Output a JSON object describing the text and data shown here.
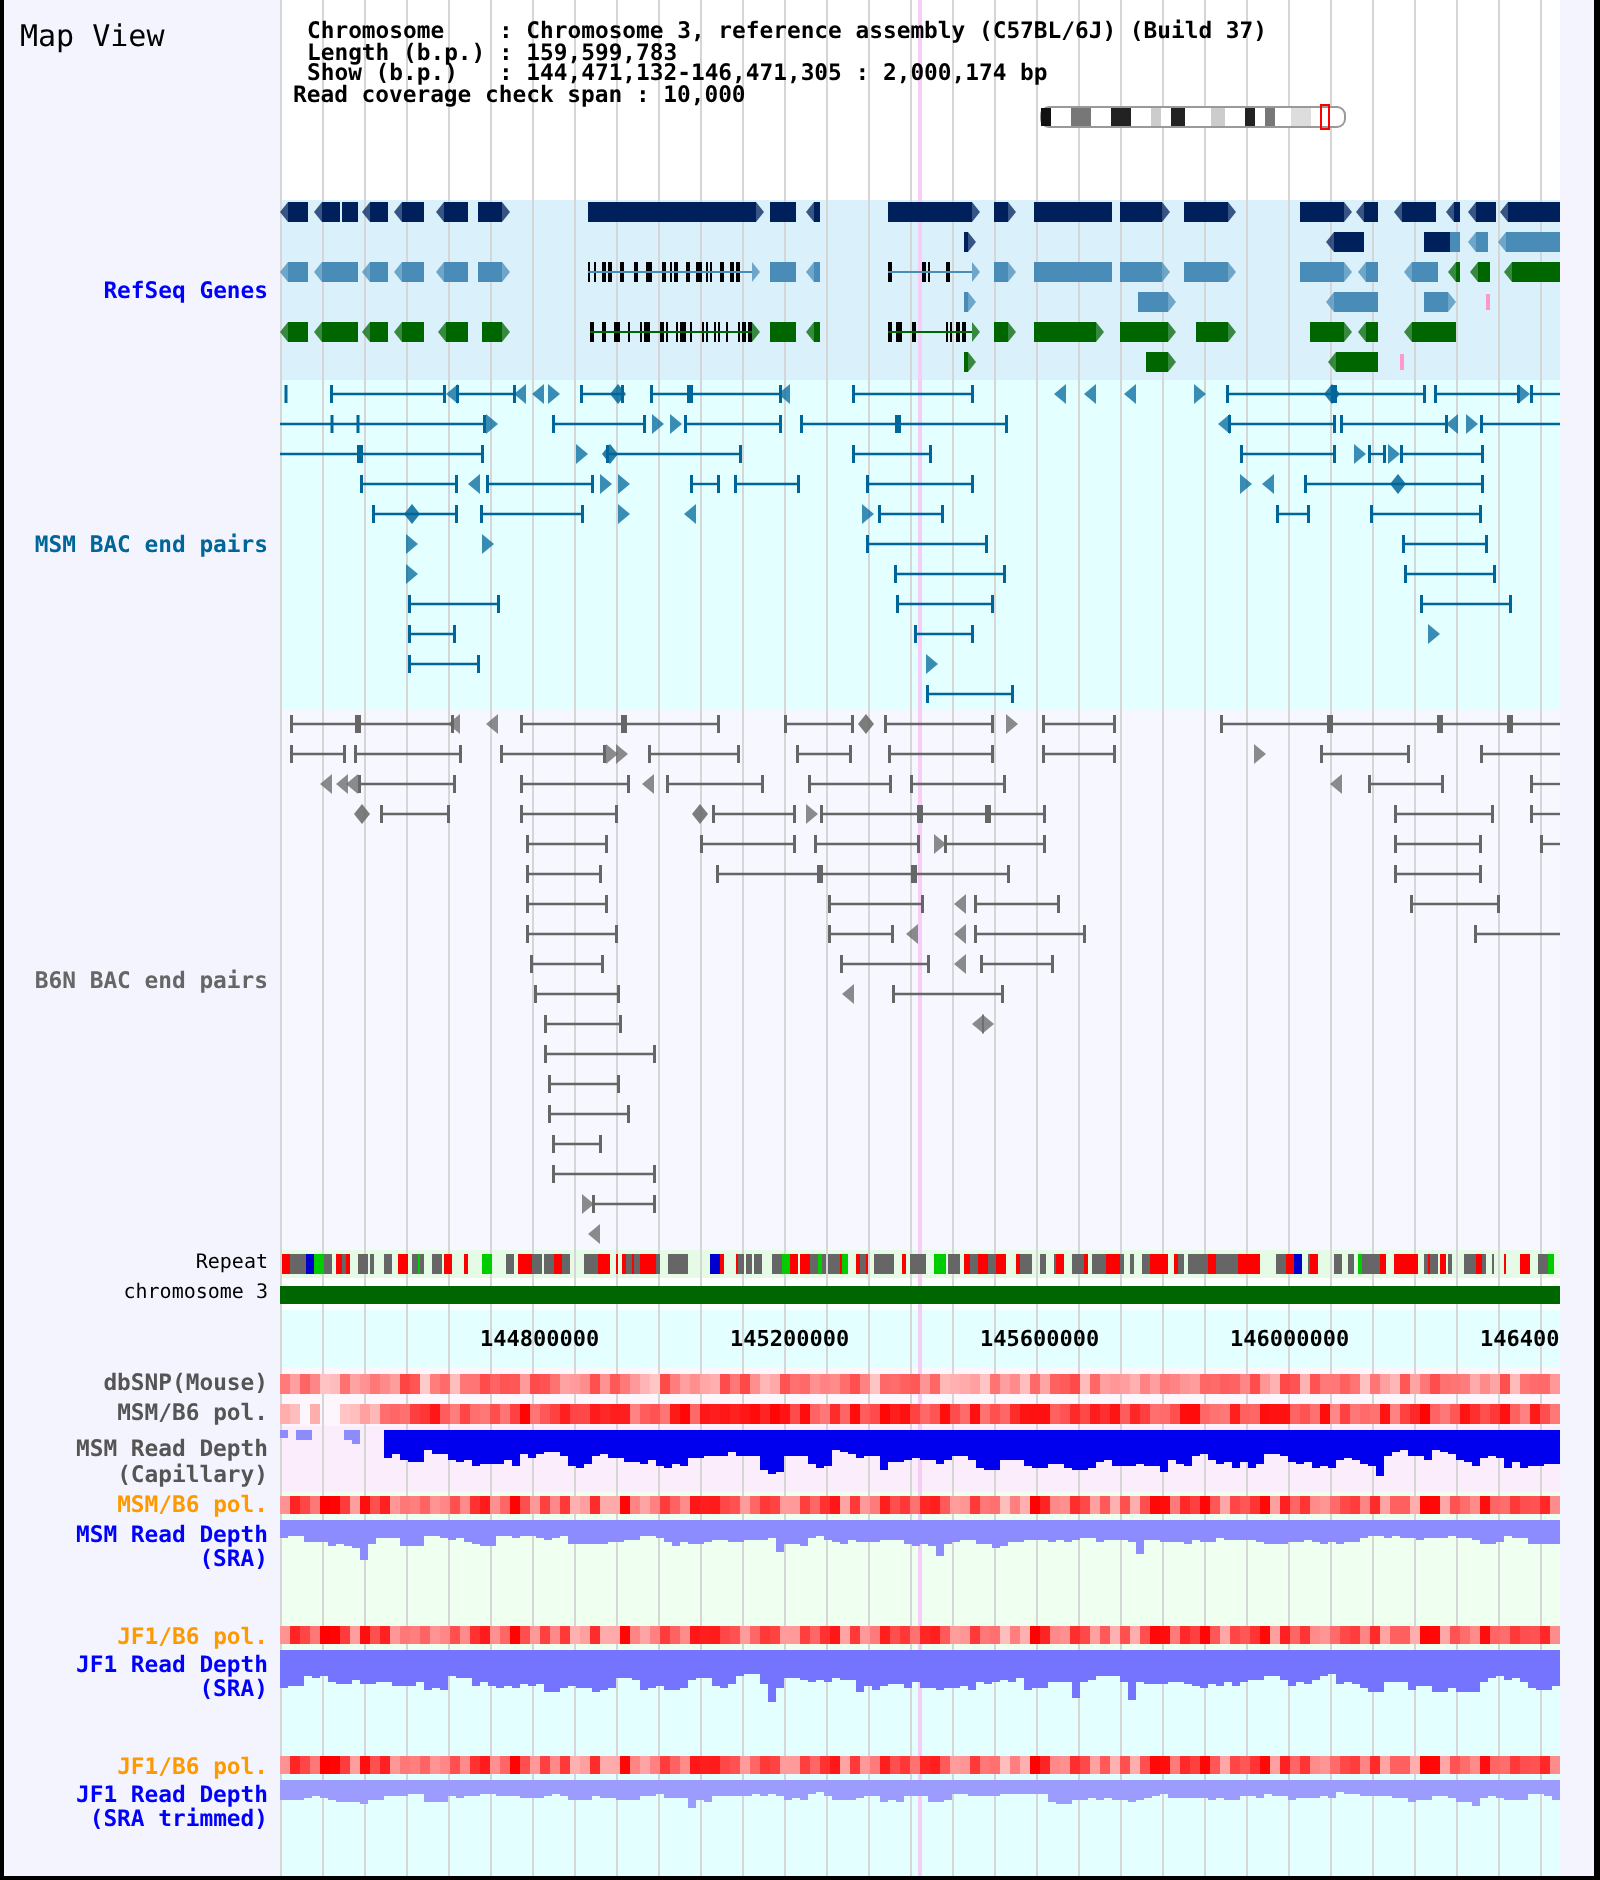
{
  "title": "Map View",
  "info": [
    {
      "label": "Chromosome",
      "sep": ":",
      "value": "Chromosome 3, reference assembly (C57BL/6J) (Build 37)"
    },
    {
      "label": "Length (b.p.)",
      "sep": ":",
      "value": "159,599,783"
    },
    {
      "label": "Show (b.p.)",
      "sep": ":",
      "value": "144,471,132-146,471,305 : 2,000,174 bp"
    }
  ],
  "coverage": {
    "label": "Read coverage check span",
    "sep": ":",
    "value": "10,000"
  },
  "tracks": [
    {
      "kind": "genes",
      "label": "RefSeq Genes",
      "color": "#0000ff"
    },
    {
      "kind": "pairs",
      "label": "MSM BAC end pairs",
      "color": "#006699"
    },
    {
      "kind": "pairs",
      "label": "B6N BAC end pairs",
      "color": "#666666"
    },
    {
      "kind": "repeat",
      "label": "Repeat",
      "color": "#000000"
    },
    {
      "kind": "chromosome",
      "label": "chromosome 3",
      "color": "#000000"
    },
    {
      "kind": "ruler",
      "ticks": [
        "144800000",
        "145200000",
        "145600000",
        "146000000",
        "146400"
      ]
    },
    {
      "kind": "heat",
      "label": "dbSNP(Mouse)",
      "color": "#555555"
    },
    {
      "kind": "heat",
      "label": "MSM/B6 pol.",
      "color": "#555555"
    },
    {
      "kind": "depth",
      "label": "MSM Read Depth (Capillary)",
      "color": "#555555"
    },
    {
      "kind": "heat",
      "label": "MSM/B6 pol.",
      "color": "#ff9900"
    },
    {
      "kind": "depth",
      "label": "MSM Read Depth (SRA)",
      "color": "#0000ff"
    },
    {
      "kind": "heat",
      "label": "JF1/B6 pol.",
      "color": "#ff9900"
    },
    {
      "kind": "depth",
      "label": "JF1 Read Depth (SRA)",
      "color": "#0000ff"
    },
    {
      "kind": "heat",
      "label": "JF1/B6 pol.",
      "color": "#ff9900"
    },
    {
      "kind": "depth",
      "label": "JF1 Read Depth (SRA trimmed)",
      "color": "#0000ff"
    }
  ]
}
